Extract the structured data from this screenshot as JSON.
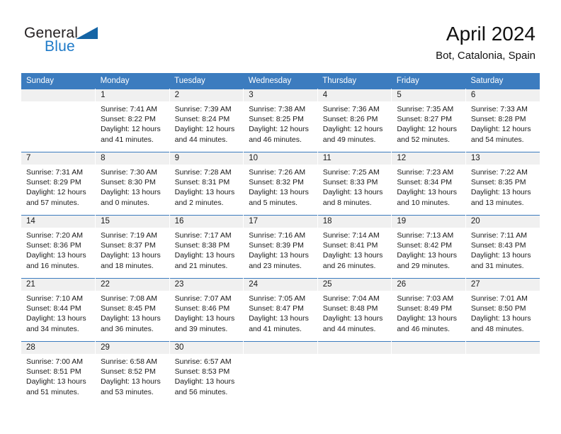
{
  "brand": {
    "name_top": "General",
    "name_bottom": "Blue",
    "triangle_icon": "triangle-logo-icon",
    "accent_color": "#1e7ac8",
    "triangle_color": "#1464a5"
  },
  "header": {
    "title": "April 2024",
    "subtitle": "Bot, Catalonia, Spain"
  },
  "calendar": {
    "header_bg": "#3c7cbf",
    "daynum_bg": "#f0f0f0",
    "weekday_headers": [
      "Sunday",
      "Monday",
      "Tuesday",
      "Wednesday",
      "Thursday",
      "Friday",
      "Saturday"
    ],
    "weeks": [
      [
        {
          "day": "",
          "empty": true,
          "lines": []
        },
        {
          "day": "1",
          "empty": false,
          "lines": [
            "Sunrise: 7:41 AM",
            "Sunset: 8:22 PM",
            "Daylight: 12 hours",
            "and 41 minutes."
          ]
        },
        {
          "day": "2",
          "empty": false,
          "lines": [
            "Sunrise: 7:39 AM",
            "Sunset: 8:24 PM",
            "Daylight: 12 hours",
            "and 44 minutes."
          ]
        },
        {
          "day": "3",
          "empty": false,
          "lines": [
            "Sunrise: 7:38 AM",
            "Sunset: 8:25 PM",
            "Daylight: 12 hours",
            "and 46 minutes."
          ]
        },
        {
          "day": "4",
          "empty": false,
          "lines": [
            "Sunrise: 7:36 AM",
            "Sunset: 8:26 PM",
            "Daylight: 12 hours",
            "and 49 minutes."
          ]
        },
        {
          "day": "5",
          "empty": false,
          "lines": [
            "Sunrise: 7:35 AM",
            "Sunset: 8:27 PM",
            "Daylight: 12 hours",
            "and 52 minutes."
          ]
        },
        {
          "day": "6",
          "empty": false,
          "lines": [
            "Sunrise: 7:33 AM",
            "Sunset: 8:28 PM",
            "Daylight: 12 hours",
            "and 54 minutes."
          ]
        }
      ],
      [
        {
          "day": "7",
          "empty": false,
          "lines": [
            "Sunrise: 7:31 AM",
            "Sunset: 8:29 PM",
            "Daylight: 12 hours",
            "and 57 minutes."
          ]
        },
        {
          "day": "8",
          "empty": false,
          "lines": [
            "Sunrise: 7:30 AM",
            "Sunset: 8:30 PM",
            "Daylight: 13 hours",
            "and 0 minutes."
          ]
        },
        {
          "day": "9",
          "empty": false,
          "lines": [
            "Sunrise: 7:28 AM",
            "Sunset: 8:31 PM",
            "Daylight: 13 hours",
            "and 2 minutes."
          ]
        },
        {
          "day": "10",
          "empty": false,
          "lines": [
            "Sunrise: 7:26 AM",
            "Sunset: 8:32 PM",
            "Daylight: 13 hours",
            "and 5 minutes."
          ]
        },
        {
          "day": "11",
          "empty": false,
          "lines": [
            "Sunrise: 7:25 AM",
            "Sunset: 8:33 PM",
            "Daylight: 13 hours",
            "and 8 minutes."
          ]
        },
        {
          "day": "12",
          "empty": false,
          "lines": [
            "Sunrise: 7:23 AM",
            "Sunset: 8:34 PM",
            "Daylight: 13 hours",
            "and 10 minutes."
          ]
        },
        {
          "day": "13",
          "empty": false,
          "lines": [
            "Sunrise: 7:22 AM",
            "Sunset: 8:35 PM",
            "Daylight: 13 hours",
            "and 13 minutes."
          ]
        }
      ],
      [
        {
          "day": "14",
          "empty": false,
          "lines": [
            "Sunrise: 7:20 AM",
            "Sunset: 8:36 PM",
            "Daylight: 13 hours",
            "and 16 minutes."
          ]
        },
        {
          "day": "15",
          "empty": false,
          "lines": [
            "Sunrise: 7:19 AM",
            "Sunset: 8:37 PM",
            "Daylight: 13 hours",
            "and 18 minutes."
          ]
        },
        {
          "day": "16",
          "empty": false,
          "lines": [
            "Sunrise: 7:17 AM",
            "Sunset: 8:38 PM",
            "Daylight: 13 hours",
            "and 21 minutes."
          ]
        },
        {
          "day": "17",
          "empty": false,
          "lines": [
            "Sunrise: 7:16 AM",
            "Sunset: 8:39 PM",
            "Daylight: 13 hours",
            "and 23 minutes."
          ]
        },
        {
          "day": "18",
          "empty": false,
          "lines": [
            "Sunrise: 7:14 AM",
            "Sunset: 8:41 PM",
            "Daylight: 13 hours",
            "and 26 minutes."
          ]
        },
        {
          "day": "19",
          "empty": false,
          "lines": [
            "Sunrise: 7:13 AM",
            "Sunset: 8:42 PM",
            "Daylight: 13 hours",
            "and 29 minutes."
          ]
        },
        {
          "day": "20",
          "empty": false,
          "lines": [
            "Sunrise: 7:11 AM",
            "Sunset: 8:43 PM",
            "Daylight: 13 hours",
            "and 31 minutes."
          ]
        }
      ],
      [
        {
          "day": "21",
          "empty": false,
          "lines": [
            "Sunrise: 7:10 AM",
            "Sunset: 8:44 PM",
            "Daylight: 13 hours",
            "and 34 minutes."
          ]
        },
        {
          "day": "22",
          "empty": false,
          "lines": [
            "Sunrise: 7:08 AM",
            "Sunset: 8:45 PM",
            "Daylight: 13 hours",
            "and 36 minutes."
          ]
        },
        {
          "day": "23",
          "empty": false,
          "lines": [
            "Sunrise: 7:07 AM",
            "Sunset: 8:46 PM",
            "Daylight: 13 hours",
            "and 39 minutes."
          ]
        },
        {
          "day": "24",
          "empty": false,
          "lines": [
            "Sunrise: 7:05 AM",
            "Sunset: 8:47 PM",
            "Daylight: 13 hours",
            "and 41 minutes."
          ]
        },
        {
          "day": "25",
          "empty": false,
          "lines": [
            "Sunrise: 7:04 AM",
            "Sunset: 8:48 PM",
            "Daylight: 13 hours",
            "and 44 minutes."
          ]
        },
        {
          "day": "26",
          "empty": false,
          "lines": [
            "Sunrise: 7:03 AM",
            "Sunset: 8:49 PM",
            "Daylight: 13 hours",
            "and 46 minutes."
          ]
        },
        {
          "day": "27",
          "empty": false,
          "lines": [
            "Sunrise: 7:01 AM",
            "Sunset: 8:50 PM",
            "Daylight: 13 hours",
            "and 48 minutes."
          ]
        }
      ],
      [
        {
          "day": "28",
          "empty": false,
          "lines": [
            "Sunrise: 7:00 AM",
            "Sunset: 8:51 PM",
            "Daylight: 13 hours",
            "and 51 minutes."
          ]
        },
        {
          "day": "29",
          "empty": false,
          "lines": [
            "Sunrise: 6:58 AM",
            "Sunset: 8:52 PM",
            "Daylight: 13 hours",
            "and 53 minutes."
          ]
        },
        {
          "day": "30",
          "empty": false,
          "lines": [
            "Sunrise: 6:57 AM",
            "Sunset: 8:53 PM",
            "Daylight: 13 hours",
            "and 56 minutes."
          ]
        },
        {
          "day": "",
          "empty": true,
          "lines": []
        },
        {
          "day": "",
          "empty": true,
          "lines": []
        },
        {
          "day": "",
          "empty": true,
          "lines": []
        },
        {
          "day": "",
          "empty": true,
          "lines": []
        }
      ]
    ]
  }
}
